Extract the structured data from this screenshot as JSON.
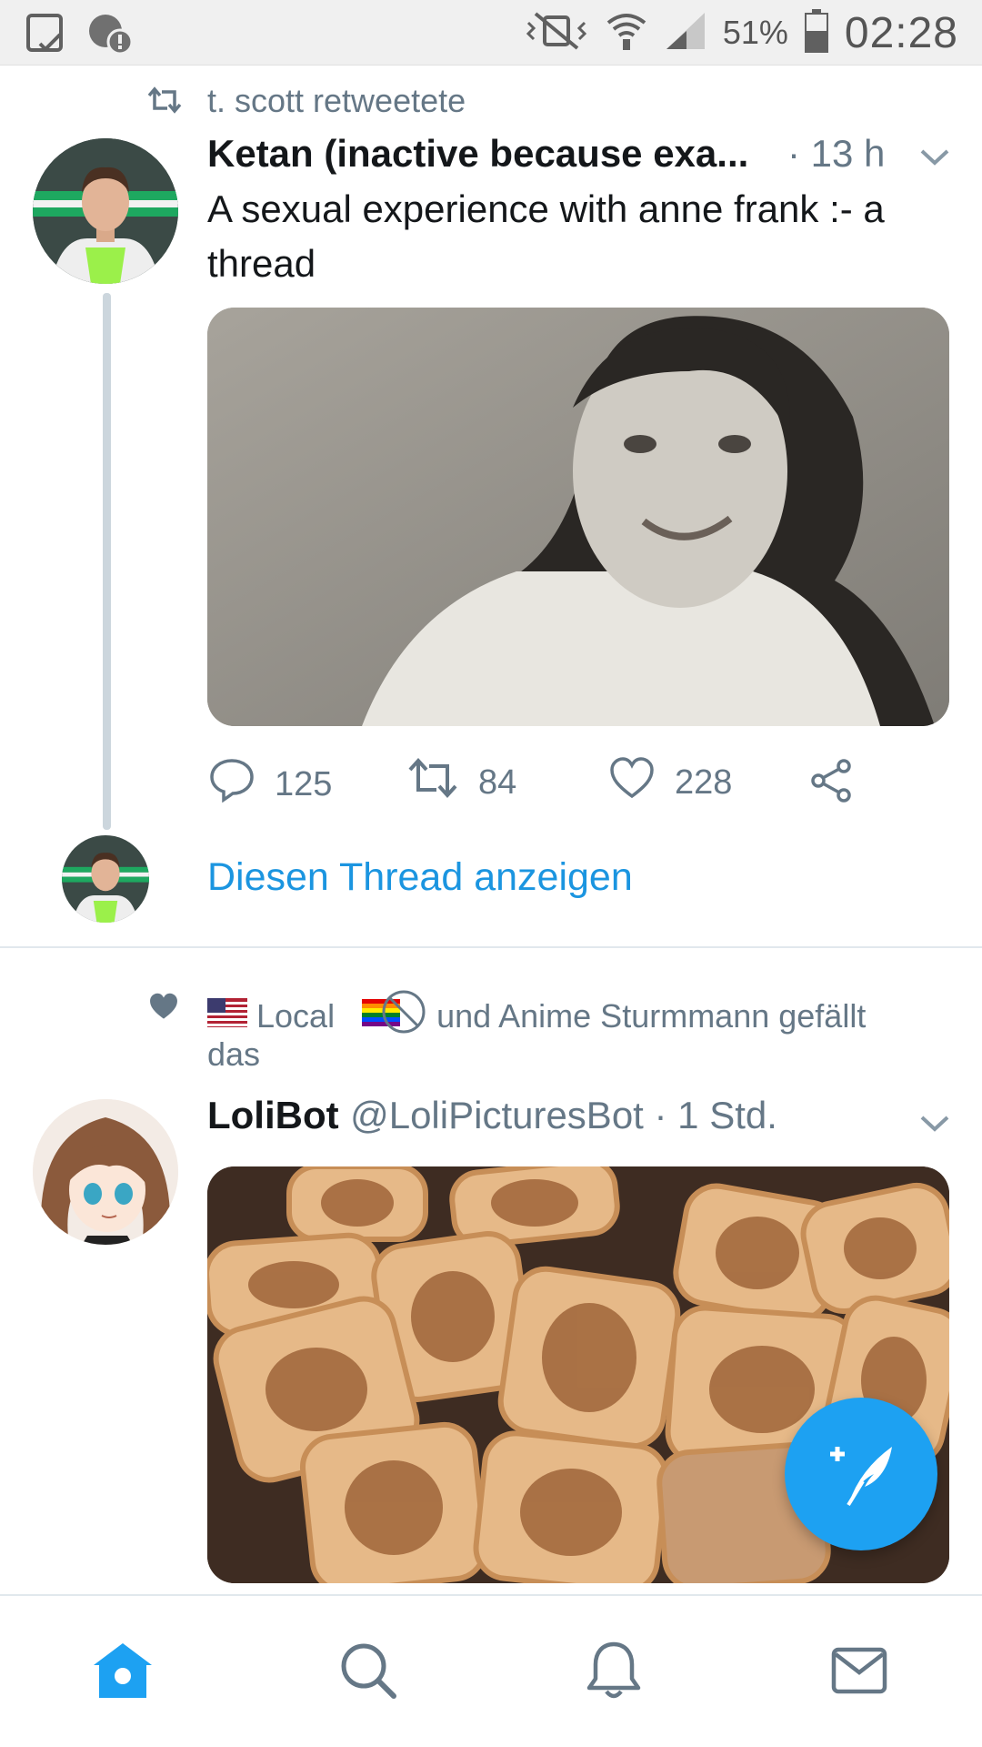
{
  "status_bar": {
    "battery_percent": "51%",
    "time": "02:28",
    "icons": [
      "tablet-check-icon",
      "app-alert-icon",
      "mute-vibrate-icon",
      "wifi-icon",
      "signal-icon",
      "battery-icon"
    ]
  },
  "tweet1": {
    "retweet_context": "t. scott retweetete",
    "display_name": "Ketan (inactive because exa...",
    "timestamp": "· 13 h",
    "text": "A sexual experience with anne frank :- a thread",
    "replies": "125",
    "retweets": "84",
    "likes": "228",
    "show_thread": "Diesen Thread anzeigen"
  },
  "tweet2": {
    "liked_by_local": "Local",
    "liked_by_rest": "und Anime Sturmmann gefällt",
    "liked_by_tail": "das",
    "display_name": "LoliBot",
    "handle_time": "@LoliPicturesBot · 1 Std."
  },
  "bottom_nav": [
    "home-icon",
    "search-icon",
    "notifications-icon",
    "messages-icon"
  ],
  "colors": {
    "accent": "#1da1f2",
    "link": "#1b95e0",
    "muted": "#657786"
  }
}
